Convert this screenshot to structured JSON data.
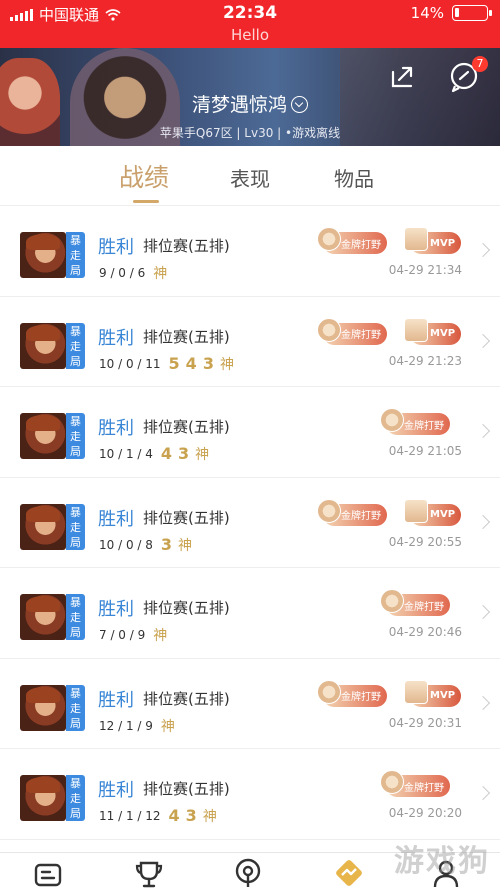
{
  "status_bar": {
    "carrier": "中国联通",
    "time": "22:34",
    "battery": "14%",
    "battery_level": 0.14,
    "subtitle": "Hello"
  },
  "header": {
    "nickname": "清梦遇惊鸿",
    "subinfo": "苹果手Q67区 | Lv30 | •游戏离线",
    "message_badge": "7"
  },
  "tabs": [
    {
      "label": "战绩",
      "active": true
    },
    {
      "label": "表现",
      "active": false
    },
    {
      "label": "物品",
      "active": false
    }
  ],
  "awards": {
    "gold_jungle": "金牌打野",
    "mvp": "MVP"
  },
  "matches": [
    {
      "mode": "暴走局",
      "result": "胜利",
      "type": "排位赛(五排)",
      "kda": "9 / 0 / 6",
      "streak": [
        "神"
      ],
      "gold": true,
      "mvp": true,
      "date": "04-29 21:34"
    },
    {
      "mode": "暴走局",
      "result": "胜利",
      "type": "排位赛(五排)",
      "kda": "10 / 0 / 11",
      "streak": [
        "5",
        "4",
        "3",
        "神"
      ],
      "gold": true,
      "mvp": true,
      "date": "04-29 21:23"
    },
    {
      "mode": "暴走局",
      "result": "胜利",
      "type": "排位赛(五排)",
      "kda": "10 / 1 / 4",
      "streak": [
        "4",
        "3",
        "神"
      ],
      "gold": true,
      "mvp": false,
      "date": "04-29 21:05"
    },
    {
      "mode": "暴走局",
      "result": "胜利",
      "type": "排位赛(五排)",
      "kda": "10 / 0 / 8",
      "streak": [
        "3",
        "神"
      ],
      "gold": true,
      "mvp": true,
      "date": "04-29 20:55"
    },
    {
      "mode": "暴走局",
      "result": "胜利",
      "type": "排位赛(五排)",
      "kda": "7 / 0 / 9",
      "streak": [
        "神"
      ],
      "gold": true,
      "mvp": false,
      "date": "04-29 20:46"
    },
    {
      "mode": "暴走局",
      "result": "胜利",
      "type": "排位赛(五排)",
      "kda": "12 / 1 / 9",
      "streak": [
        "神"
      ],
      "gold": true,
      "mvp": true,
      "date": "04-29 20:31"
    },
    {
      "mode": "暴走局",
      "result": "胜利",
      "type": "排位赛(五排)",
      "kda": "11 / 1 / 12",
      "streak": [
        "4",
        "3",
        "神"
      ],
      "gold": true,
      "mvp": false,
      "date": "04-29 20:20"
    }
  ],
  "watermark": "游戏狗",
  "colors": {
    "status_bar": "#f0262a",
    "tab_active": "#c9a06b",
    "result_blue": "#3a86d6",
    "mode_badge": "#3d8be0",
    "streak_gold": "#c9a24f"
  },
  "icons": {
    "share": "share-icon",
    "message": "message-icon",
    "bottom_nav": [
      "card-icon",
      "trophy-icon",
      "broadcast-icon",
      "activity-icon",
      "profile-icon"
    ]
  }
}
